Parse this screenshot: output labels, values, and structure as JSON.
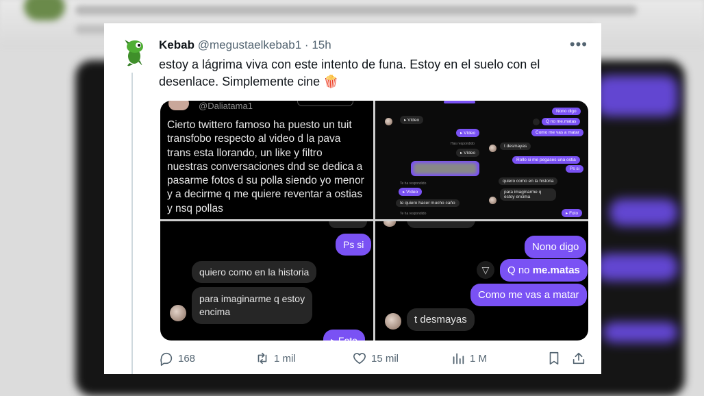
{
  "tweet": {
    "name": "Kebab",
    "handle": "@megustaelkebab1",
    "separator": "·",
    "time": "15h",
    "more": "•••",
    "text": "estoy a lágrima viva con este intento de funa. Estoy en el suelo con el desenlace. Simplemente cine 🍿"
  },
  "media": {
    "q1": {
      "handle": "@Daliatama1",
      "text": "Cierto twittero famoso ha puesto un tuit transfobo respecto al video d la pava trans esta llorando, un like y filtro nuestras conversaciones dnd se dedica a pasarme fotos d su polla siendo yo menor y a decirme q me quiere reventar a ostias y nsq pollas"
    },
    "q2": {
      "video1": "▸ Vídeo",
      "video2": "▸ Vídeo",
      "video3": "▸ Vídeo",
      "video4": "▸ Vídeo",
      "responded1": "Has respondido",
      "responded2": "Te ha respondido",
      "responded3": "Te ha respondido",
      "nono": "Nono digo",
      "qno": "Q no me.matas",
      "como": "Como me vas a matar",
      "desmayas": "t desmayas",
      "rollo": "Rollo si me pegases una ostia",
      "pssi": "Ps si",
      "quiero": "quiero como en la historia",
      "para": "para imaginarme q estoy encima",
      "caño": "te quiero hacer mucho caño",
      "foto": "▸ Foto"
    },
    "q3": {
      "pssi": "Ps si",
      "quiero": "quiero como en la historia",
      "para": "para imaginarme q estoy\nencima",
      "foto": "▸ Foto"
    },
    "q4": {
      "nono": "Nono digo",
      "qno_prefix": "Q no ",
      "qno_bold": "me.matas",
      "como": "Como me vas a matar",
      "desmayas": "t desmayas"
    }
  },
  "actions": {
    "replies": "168",
    "retweets": "1 mil",
    "likes": "15 mil",
    "views": "1 M"
  },
  "colors": {
    "accent_purple": "#7a52f4",
    "muted": "#536471"
  }
}
